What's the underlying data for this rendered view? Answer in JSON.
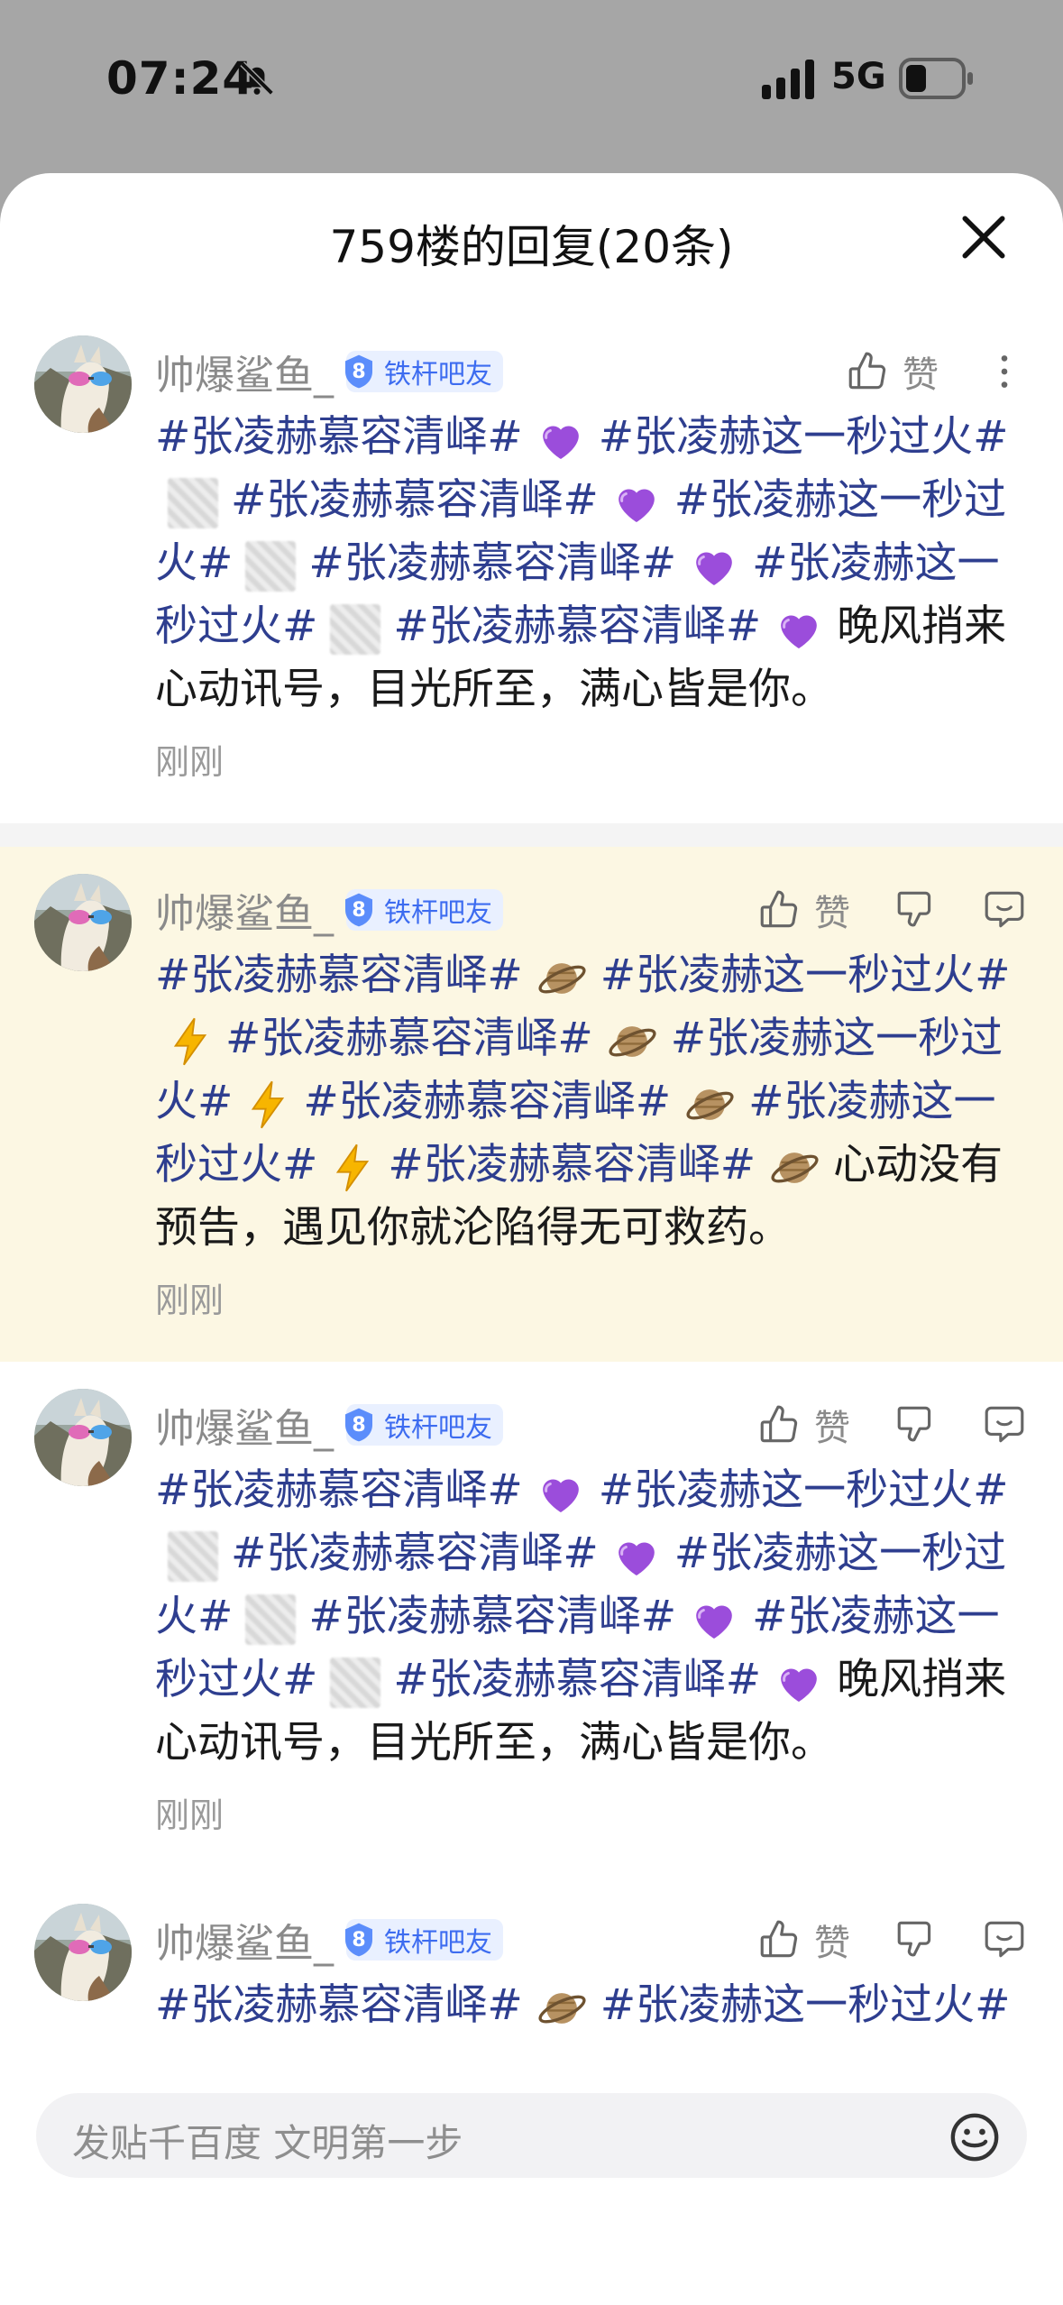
{
  "status_bar": {
    "time": "07:24",
    "network": "5G"
  },
  "sheet": {
    "title": "759楼的回复(20条)"
  },
  "replies": [
    {
      "username": "帅爆鲨鱼_",
      "level": "8",
      "badge": "铁杆吧友",
      "like_label": "赞",
      "time": "刚刚",
      "tags": [
        "#张凌赫慕容清峄#",
        "#张凌赫这一秒过火#",
        "#张凌赫慕容清峄#",
        "#张凌赫这一秒过",
        "火#",
        "#张凌赫慕容清峄#",
        "#张凌赫这一秒",
        "过火#",
        "#张凌赫慕容清峄#"
      ],
      "text": "晚风捎来心动讯号，目光所至，满心皆是你。",
      "emoji_a": "purple-heart",
      "emoji_b": "blurred-sticker"
    },
    {
      "username": "帅爆鲨鱼_",
      "level": "8",
      "badge": "铁杆吧友",
      "like_label": "赞",
      "time": "刚刚",
      "tags": [
        "#张凌赫慕容清峄#",
        "#张凌赫这一秒过火#",
        "#张凌赫慕容清峄#",
        "#张凌赫这一秒过",
        "火#",
        "#张凌赫慕容清峄#",
        "#张凌赫这一秒",
        "过火#",
        "#张凌赫慕容清峄#"
      ],
      "text": "心动没有预告，遇见你就沦陷得无可救药。",
      "emoji_a": "ringed-planet",
      "emoji_b": "lightning"
    },
    {
      "username": "帅爆鲨鱼_",
      "level": "8",
      "badge": "铁杆吧友",
      "like_label": "赞",
      "time": "刚刚",
      "tags": [
        "#张凌赫慕容清峄#",
        "#张凌赫这一秒过火#",
        "#张凌赫慕容清峄#",
        "#张凌赫这一秒过",
        "火#",
        "#张凌赫慕容清峄#",
        "#张凌赫这一秒",
        "过火#",
        "#张凌赫慕容清峄#"
      ],
      "text": "晚风捎来心动讯号，目光所至，满心皆是你。",
      "emoji_a": "purple-heart",
      "emoji_b": "blurred-sticker"
    },
    {
      "username": "帅爆鲨鱼_",
      "level": "8",
      "badge": "铁杆吧友",
      "like_label": "赞",
      "time": "",
      "tags": [
        "#张凌赫慕容清峄#",
        "#张凌赫这一秒过火#"
      ],
      "text": "",
      "emoji_a": "ringed-planet",
      "emoji_b": ""
    }
  ],
  "bottom_bar": {
    "input_placeholder": "发贴千百度 文明第一步"
  },
  "colors": {
    "tag": "#2e3e8f",
    "highlight_bg": "#fcf7e3",
    "badge_text": "#3d6cf0"
  }
}
